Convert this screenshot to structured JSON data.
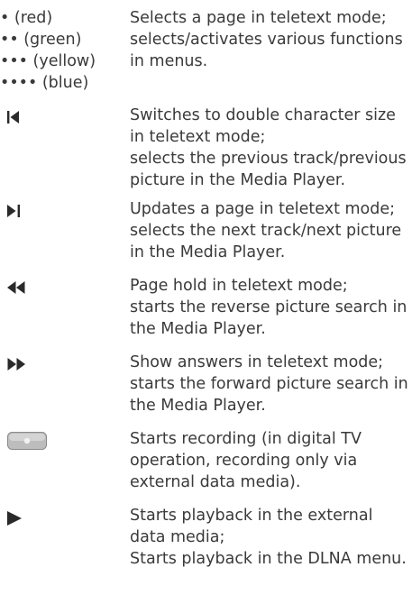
{
  "color_keys": {
    "keys": [
      "• (red)",
      "•• (green)",
      "••• (yellow)",
      "•••• (blue)"
    ],
    "desc": [
      "Selects a page in teletext mode;",
      "selects/activates various functions",
      "in menus."
    ]
  },
  "entries": [
    {
      "icon": "previous-track-icon",
      "lines": [
        "Switches to double character size",
        "in teletext mode;",
        "selects the previous track/previous",
        "picture in the Media Player."
      ]
    },
    {
      "icon": "next-track-icon",
      "lines": [
        "Updates a page in teletext mode;",
        "selects the next track/next picture",
        "in the Media Player."
      ]
    },
    {
      "icon": "rewind-icon",
      "lines": [
        "Page hold in teletext mode;",
        "starts the reverse picture search in",
        "the Media Player."
      ]
    },
    {
      "icon": "fast-forward-icon",
      "lines": [
        "Show answers in teletext mode;",
        "starts the forward picture search in",
        "the Media Player."
      ]
    },
    {
      "icon": "record-icon",
      "lines": [
        "Starts recording (in digital TV",
        "operation, recording only via",
        "external data media)."
      ]
    },
    {
      "icon": "play-icon",
      "lines": [
        "Starts playback in the external",
        "data media;",
        "Starts playback in the DLNA menu."
      ]
    }
  ]
}
